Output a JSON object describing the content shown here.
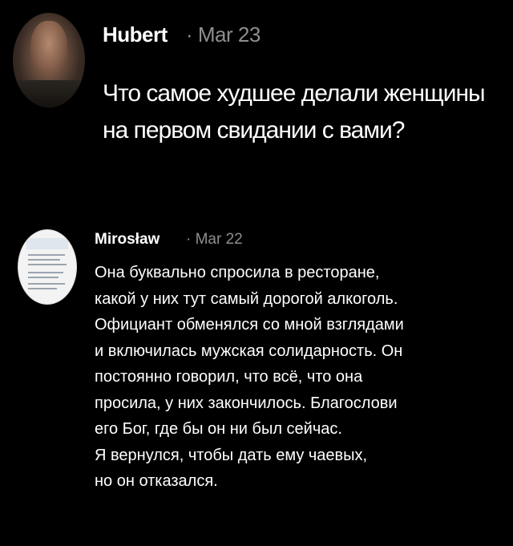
{
  "main_post": {
    "author": "Hubert",
    "date": "· Mar 23",
    "lines": [
      "Что самое худшее делали женщины",
      "на первом свидании с вами?"
    ]
  },
  "reply_post": {
    "author": "Mirosław",
    "date": "· Mar 22",
    "lines": [
      "Она буквально спросила в ресторане,",
      "какой у них тут самый дорогой алкоголь.",
      "Официант обменялся со мной взглядами",
      "и включилась мужская солидарность. Он",
      "постоянно говорил, что всё, что она",
      "просила, у них закончилось. Благослови",
      "его Бог, где бы он ни был сейчас.",
      "Я вернулся, чтобы дать ему чаевых,",
      "но он отказался."
    ]
  },
  "colors": {
    "background": "#000000",
    "text": "#ffffff",
    "muted": "#8e8e8e"
  }
}
